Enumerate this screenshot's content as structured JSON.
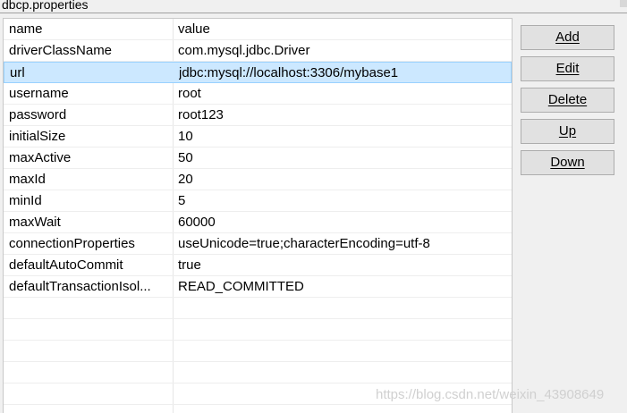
{
  "window": {
    "title": "dbcp.properties"
  },
  "table": {
    "columns": [
      "name",
      "value"
    ],
    "rows": [
      {
        "name": "driverClassName",
        "value": "com.mysql.jdbc.Driver"
      },
      {
        "name": "url",
        "value": "jdbc:mysql://localhost:3306/mybase1"
      },
      {
        "name": "username",
        "value": "root"
      },
      {
        "name": "password",
        "value": "root123"
      },
      {
        "name": "initialSize",
        "value": "10"
      },
      {
        "name": "maxActive",
        "value": "50"
      },
      {
        "name": "maxId",
        "value": "20"
      },
      {
        "name": "minId",
        "value": "5"
      },
      {
        "name": "maxWait",
        "value": "60000"
      },
      {
        "name": "connectionProperties",
        "value": "useUnicode=true;characterEncoding=utf-8"
      },
      {
        "name": "defaultAutoCommit",
        "value": "true"
      },
      {
        "name": "defaultTransactionIsol...",
        "value": "READ_COMMITTED"
      }
    ],
    "selected_index": 1,
    "empty_rows": 5
  },
  "buttons": {
    "add": "Add",
    "edit": "Edit",
    "delete": "Delete",
    "up": "Up",
    "down": "Down"
  },
  "watermark": "https://blog.csdn.net/weixin_43908649",
  "colors": {
    "selection_bg": "#cce8ff",
    "selection_border": "#99d1ff",
    "button_bg": "#e1e1e1"
  }
}
